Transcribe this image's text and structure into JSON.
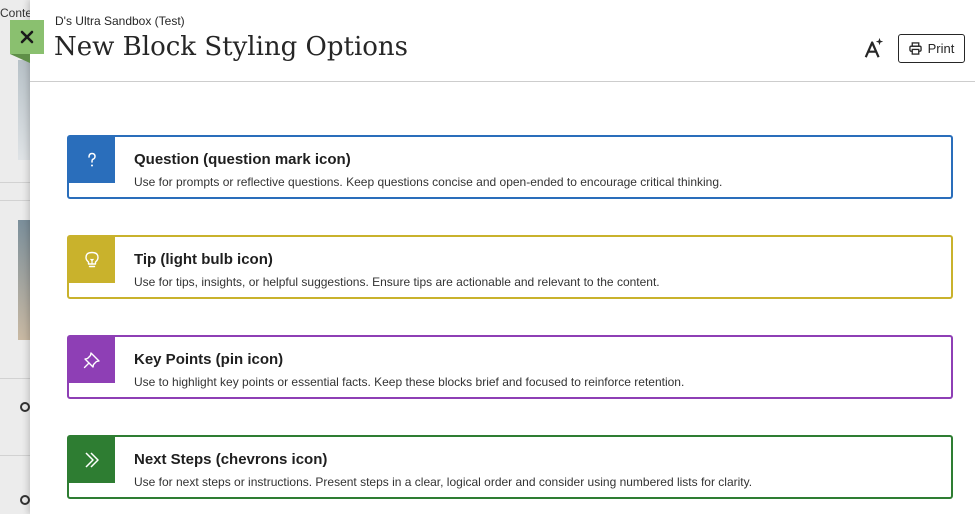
{
  "background": {
    "partial_text": "Conter"
  },
  "close_button": {
    "icon": "close-icon",
    "color": "#8ac06f"
  },
  "header": {
    "course_name": "D's Ultra Sandbox (Test)",
    "title": "New Block Styling Options",
    "ai_icon": "ai-assist-icon",
    "print_label": "Print"
  },
  "blocks": [
    {
      "title": "Question (question mark icon)",
      "description": "Use for prompts or reflective questions. Keep questions concise and open-ended to encourage critical thinking.",
      "icon": "question-mark-icon",
      "color": "#2a6ebb"
    },
    {
      "title": "Tip (light bulb icon)",
      "description": "Use for tips, insights, or helpful suggestions. Ensure tips are actionable and relevant to the content.",
      "icon": "light-bulb-icon",
      "color": "#c9b22c"
    },
    {
      "title": "Key Points (pin icon)",
      "description": "Use to highlight key points or essential facts. Keep these blocks brief and focused to reinforce retention.",
      "icon": "pin-icon",
      "color": "#8e3fb5"
    },
    {
      "title": "Next Steps (chevrons icon)",
      "description": "Use for next steps or instructions. Present steps in a clear, logical order and consider using numbered lists for clarity.",
      "icon": "chevrons-icon",
      "color": "#2e7d32"
    }
  ]
}
